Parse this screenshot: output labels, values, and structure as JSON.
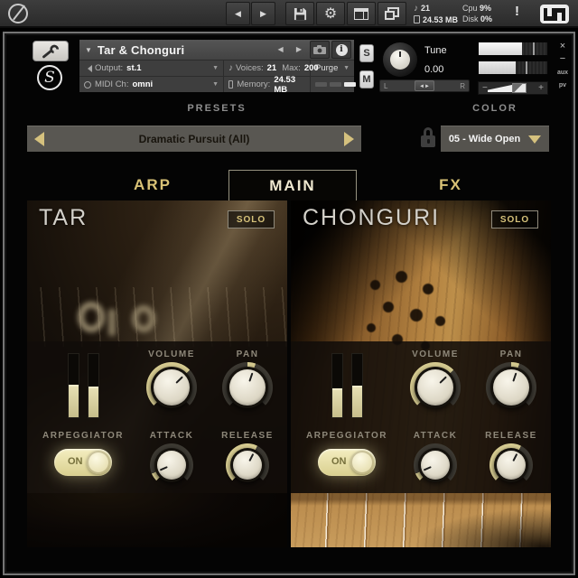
{
  "accent_gold": "#d5c17e",
  "top_bar": {
    "nav_prev": "◀",
    "nav_next": "▶",
    "voices_icon": "♪",
    "voices": "21",
    "memory": "24.53 MB",
    "cpu_label": "Cpu",
    "cpu_value": "9%",
    "disk_label": "Disk",
    "disk_value": "0%",
    "alert": "!"
  },
  "header": {
    "collapse_caret": "▼",
    "title": "Tar & Chonguri",
    "nav_arrows": "◀ ▶",
    "output_label": "Output:",
    "output_value": "st.1",
    "midi_label": "MIDI Ch:",
    "midi_value": "omni",
    "voices_label": "Voices:",
    "voices_value": "21",
    "max_label": "Max:",
    "max_value": "200",
    "memory_label": "Memory:",
    "memory_value": "24.53 MB",
    "purge_label": "Purge",
    "purge_caret": "▼",
    "row_caret": "▼",
    "solo_btn": "S",
    "mute_btn": "M",
    "tune": {
      "label": "Tune",
      "value": "0.00"
    },
    "pan": {
      "left": "L",
      "right": "R",
      "center_icon": "◄►"
    },
    "meters": {
      "top": {
        "fill": 63,
        "peak": 79
      },
      "bottom": {
        "fill": 54,
        "peak": 69
      }
    },
    "volume_slider": {
      "minus": "−",
      "plus": "+",
      "pct": 62
    },
    "window_controls": {
      "close": "×",
      "minimize": "−",
      "aux": "aux",
      "pv": "pv"
    }
  },
  "presets": {
    "label": "PRESETS",
    "value": "Dramatic Pursuit (All)"
  },
  "color_menu": {
    "label": "COLOR",
    "value": "05 - Wide Open"
  },
  "tabs": {
    "arp": "ARP",
    "main": "MAIN",
    "fx": "FX"
  },
  "panels": [
    {
      "title": "TAR",
      "solo_label": "SOLO",
      "meters": [
        52,
        48
      ],
      "volume": {
        "label": "VOLUME",
        "pct": 67
      },
      "pan": {
        "label": "PAN",
        "pct": 57
      },
      "arp": {
        "label": "ARPEGGIATOR",
        "state": "ON"
      },
      "attack": {
        "label": "ATTACK",
        "pct": 8
      },
      "release": {
        "label": "RELEASE",
        "pct": 60
      }
    },
    {
      "title": "CHONGURI",
      "solo_label": "SOLO",
      "meters": [
        46,
        50
      ],
      "volume": {
        "label": "VOLUME",
        "pct": 67
      },
      "pan": {
        "label": "PAN",
        "pct": 57
      },
      "arp": {
        "label": "ARPEGGIATOR",
        "state": "ON"
      },
      "attack": {
        "label": "ATTACK",
        "pct": 8
      },
      "release": {
        "label": "RELEASE",
        "pct": 60
      }
    }
  ]
}
